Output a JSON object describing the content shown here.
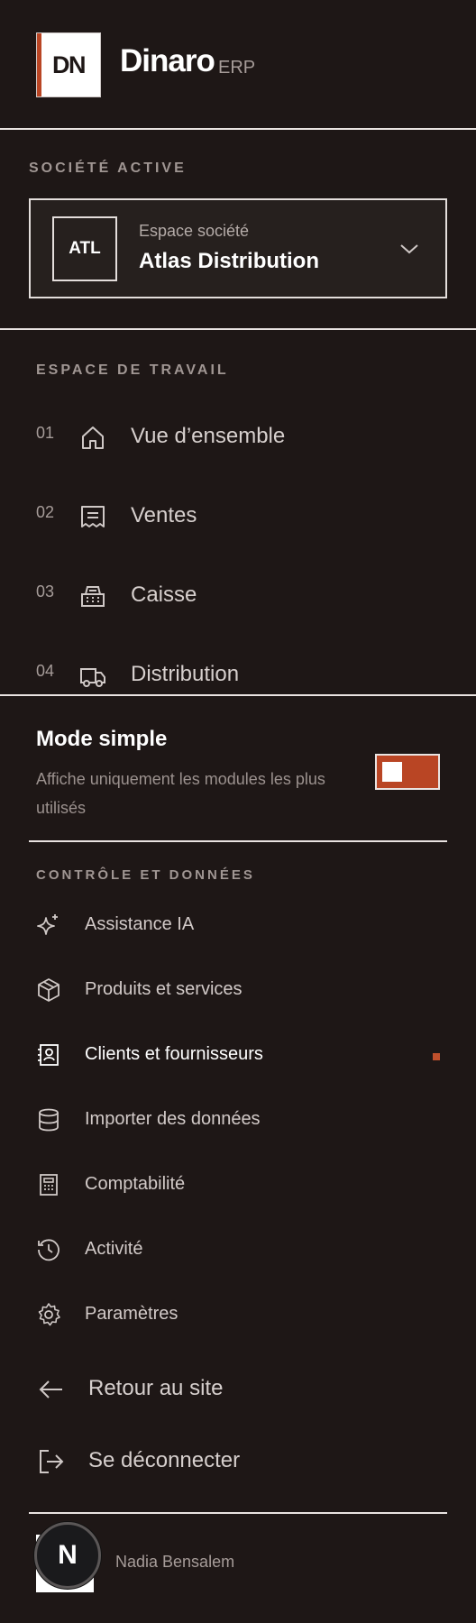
{
  "brand": {
    "logo": "DN",
    "name": "Dinaro",
    "suffix": "ERP"
  },
  "company": {
    "section_label": "SOCIÉTÉ ACTIVE",
    "badge": "ATL",
    "caption": "Espace société",
    "name": "Atlas Distribution"
  },
  "workspace": {
    "section_label": "ESPACE DE TRAVAIL",
    "items": [
      {
        "num": "01",
        "label": "Vue d’ensemble",
        "icon": "home-icon"
      },
      {
        "num": "02",
        "label": "Ventes",
        "icon": "receipt-icon"
      },
      {
        "num": "03",
        "label": "Caisse",
        "icon": "cash-register-icon"
      },
      {
        "num": "04",
        "label": "Distribution",
        "icon": "truck-icon"
      }
    ]
  },
  "mode": {
    "title": "Mode simple",
    "description": "Affiche uniquement les modules les plus utilisés",
    "enabled": true
  },
  "control": {
    "section_label": "CONTRÔLE ET DONNÉES",
    "items": [
      {
        "label": "Assistance IA",
        "icon": "sparkles-icon"
      },
      {
        "label": "Produits et services",
        "icon": "package-icon"
      },
      {
        "label": "Clients et fournisseurs",
        "icon": "contact-book-icon",
        "active": true
      },
      {
        "label": "Importer des données",
        "icon": "database-icon"
      },
      {
        "label": "Comptabilité",
        "icon": "calculator-icon"
      },
      {
        "label": "Activité",
        "icon": "history-icon"
      },
      {
        "label": "Paramètres",
        "icon": "gear-icon"
      }
    ]
  },
  "footer": {
    "back_label": "Retour au site",
    "logout_label": "Se déconnecter",
    "user_initial": "N",
    "user_name": "Nadia Bensalem"
  },
  "colors": {
    "background": "#1e1716",
    "accent": "#b94524",
    "divider": "#e9e3e1"
  }
}
